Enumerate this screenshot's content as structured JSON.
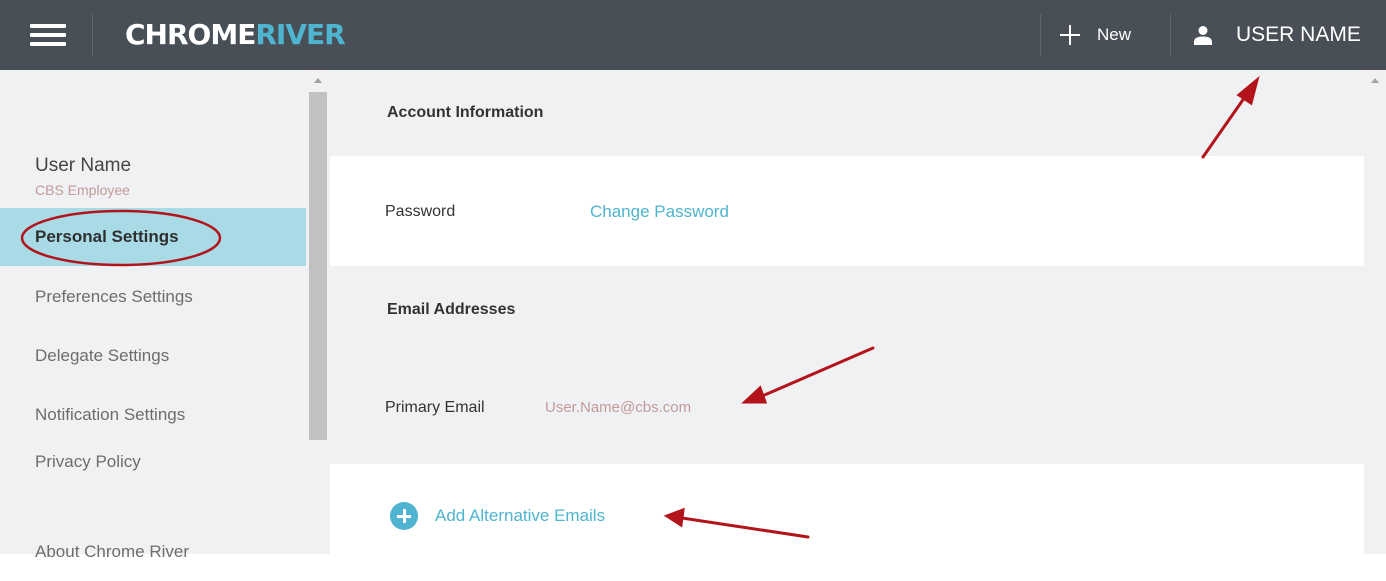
{
  "header": {
    "logo_part1": "CHROME",
    "logo_part2": "RIVER",
    "new_label": "New",
    "user_label": "USER NAME",
    "icons": [
      "menu-icon",
      "plus-icon",
      "user-icon"
    ]
  },
  "sidebar": {
    "user_name": "User  Name",
    "user_role": "CBS Employee",
    "items": [
      {
        "label": "Personal Settings",
        "active": true
      },
      {
        "label": "Preferences Settings",
        "active": false
      },
      {
        "label": "Delegate Settings",
        "active": false
      },
      {
        "label": "Notification Settings",
        "active": false
      },
      {
        "label": "Privacy Policy",
        "active": false
      },
      {
        "label": "About Chrome River",
        "active": false
      }
    ]
  },
  "main": {
    "account_section_title": "Account Information",
    "password_label": "Password",
    "change_password_link": "Change Password",
    "email_section_title": "Email Addresses",
    "primary_email_label": "Primary Email",
    "primary_email_value": "User.Name@cbs.com",
    "add_alt_emails_label": "Add Alternative Emails"
  },
  "colors": {
    "topbar": "#484f56",
    "accent": "#4fb4cf",
    "active_item": "#a8dbe6",
    "annotation": "#b3131b"
  }
}
